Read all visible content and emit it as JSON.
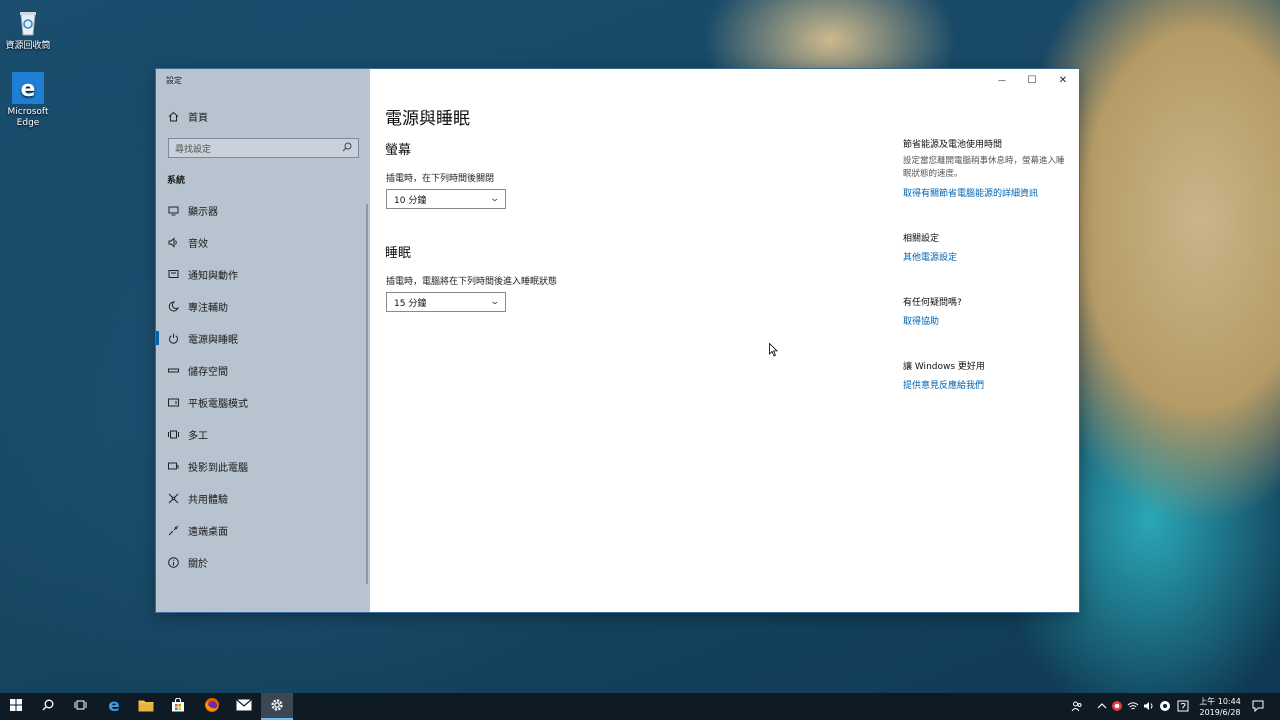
{
  "desktop": {
    "icons": [
      {
        "label": "資源回收筒",
        "icon": "recycle-bin-icon"
      },
      {
        "label": "Microsoft Edge",
        "icon": "edge-icon"
      }
    ]
  },
  "window": {
    "title": "設定",
    "controls": {
      "minimize": "—",
      "maximize": "☐",
      "close": "✕"
    }
  },
  "sidebar": {
    "home": "首頁",
    "search_placeholder": "尋找設定",
    "section": "系統",
    "items": [
      {
        "label": "顯示器",
        "icon": "display-icon"
      },
      {
        "label": "音效",
        "icon": "sound-icon"
      },
      {
        "label": "通知與動作",
        "icon": "notifications-icon"
      },
      {
        "label": "專注輔助",
        "icon": "focus-assist-icon"
      },
      {
        "label": "電源與睡眠",
        "icon": "power-icon",
        "active": true
      },
      {
        "label": "儲存空間",
        "icon": "storage-icon"
      },
      {
        "label": "平板電腦模式",
        "icon": "tablet-mode-icon"
      },
      {
        "label": "多工",
        "icon": "multitasking-icon"
      },
      {
        "label": "投影到此電腦",
        "icon": "projecting-icon"
      },
      {
        "label": "共用體驗",
        "icon": "shared-experiences-icon"
      },
      {
        "label": "遠端桌面",
        "icon": "remote-desktop-icon"
      },
      {
        "label": "關於",
        "icon": "about-icon"
      }
    ]
  },
  "main": {
    "title": "電源與睡眠",
    "screen": {
      "heading": "螢幕",
      "label": "插電時，在下列時間後關閉",
      "value": "10 分鐘"
    },
    "sleep": {
      "heading": "睡眠",
      "label": "插電時，電腦將在下列時間後進入睡眠狀態",
      "value": "15 分鐘"
    }
  },
  "rail": {
    "battery": {
      "heading": "節省能源及電池使用時間",
      "text": "設定當您離開電腦稍事休息時，螢幕進入睡眠狀態的速度。",
      "link": "取得有關節省電腦能源的詳細資訊"
    },
    "related": {
      "heading": "相關設定",
      "link": "其他電源設定"
    },
    "question": {
      "heading": "有任何疑問嗎?",
      "link": "取得協助"
    },
    "feedback": {
      "heading": "讓 Windows 更好用",
      "link": "提供意見反應給我們"
    }
  },
  "taskbar": {
    "clock_time": "上午 10:44",
    "clock_date": "2019/6/28"
  }
}
